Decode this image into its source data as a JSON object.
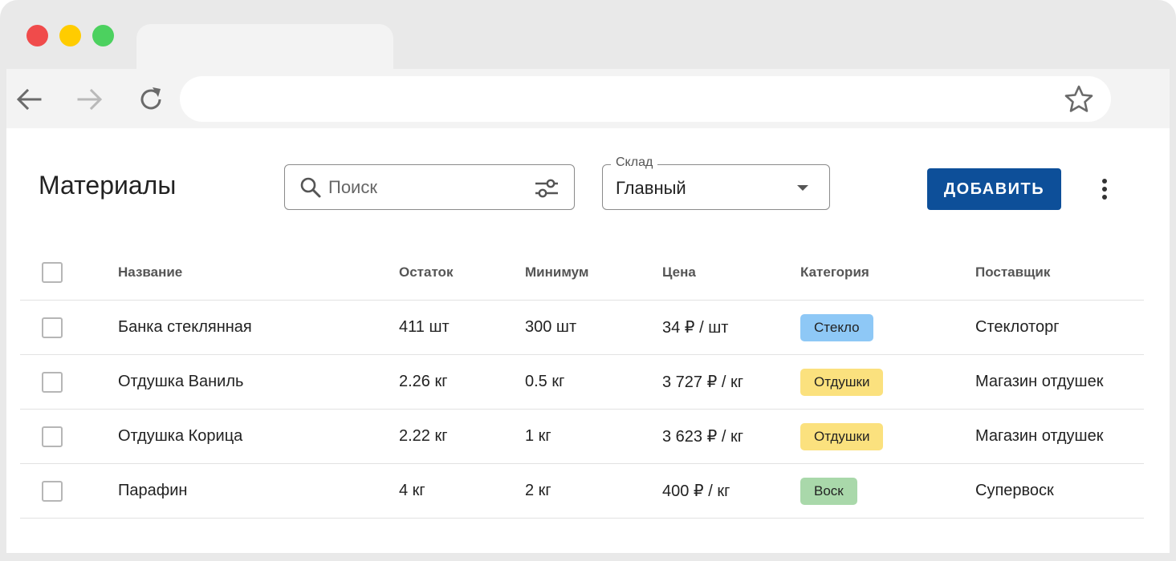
{
  "browser": {
    "address_value": "",
    "icons": [
      "back-icon",
      "forward-icon",
      "reload-icon",
      "star-icon"
    ],
    "traffic_colors": [
      "#f04b4b",
      "#ffcc00",
      "#4cd15f"
    ]
  },
  "page": {
    "title": "Материалы",
    "search": {
      "placeholder": "Поиск",
      "value": ""
    },
    "warehouse": {
      "label": "Склад",
      "value": "Главный"
    },
    "add_label": "ДОБАВИТЬ",
    "accent": "#0d4f99"
  },
  "table": {
    "columns": [
      "Название",
      "Остаток",
      "Минимум",
      "Цена",
      "Категория",
      "Поставщик"
    ],
    "rows": [
      {
        "name": "Банка стеклянная",
        "stock": "411 шт",
        "min": "300 шт",
        "price": "34 ₽ / шт",
        "category": "Стекло",
        "category_color": "#8ec8f6",
        "supplier": "Стеклоторг"
      },
      {
        "name": "Отдушка Ваниль",
        "stock": "2.26 кг",
        "min": "0.5 кг",
        "price": "3 727 ₽ / кг",
        "category": "Отдушки",
        "category_color": "#fbe17e",
        "supplier": "Магазин отдушек"
      },
      {
        "name": "Отдушка Корица",
        "stock": "2.22 кг",
        "min": "1 кг",
        "price": "3 623 ₽ / кг",
        "category": "Отдушки",
        "category_color": "#fbe17e",
        "supplier": "Магазин отдушек"
      },
      {
        "name": "Парафин",
        "stock": "4 кг",
        "min": "2 кг",
        "price": "400 ₽ / кг",
        "category": "Воск",
        "category_color": "#a9d8aa",
        "supplier": "Супервоск"
      }
    ]
  }
}
